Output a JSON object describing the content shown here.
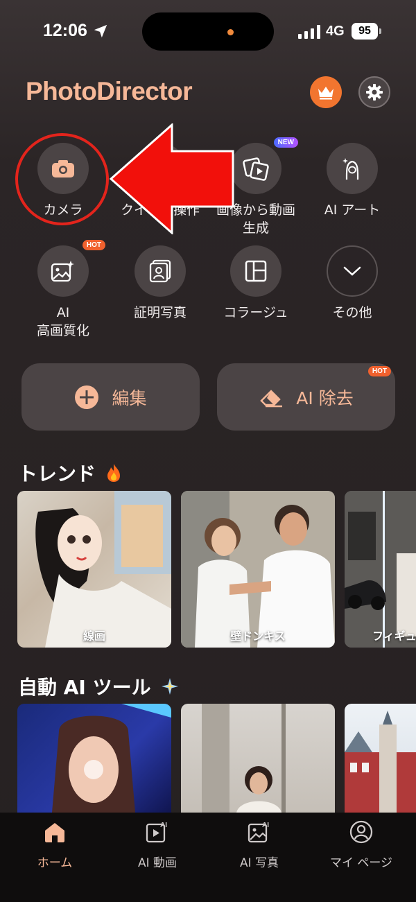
{
  "status_bar": {
    "time": "12:06",
    "network": "4G",
    "battery": "95"
  },
  "header": {
    "title": "PhotoDirector"
  },
  "tools": [
    {
      "label": "カメラ",
      "icon": "camera-icon"
    },
    {
      "label": "クイック操作",
      "icon": "quick-action-icon"
    },
    {
      "label": "画像から動画\n生成",
      "icon": "image-to-video-icon",
      "badge": "NEW"
    },
    {
      "label": "AI アート",
      "icon": "ai-art-icon"
    },
    {
      "label": "AI\n高画質化",
      "icon": "enhance-icon",
      "badge": "HOT"
    },
    {
      "label": "証明写真",
      "icon": "id-photo-icon"
    },
    {
      "label": "コラージュ",
      "icon": "collage-icon"
    },
    {
      "label": "その他",
      "icon": "chevron-down-icon"
    }
  ],
  "actions": {
    "edit": {
      "label": "編集",
      "icon": "plus-icon"
    },
    "remove": {
      "label": "AI 除去",
      "icon": "eraser-icon",
      "badge": "HOT"
    }
  },
  "sections": {
    "trend": {
      "title": "トレンド",
      "icon": "fire-icon",
      "cards": [
        {
          "caption": "線画"
        },
        {
          "caption": "壁ドンキス"
        },
        {
          "caption": "フィギュ"
        }
      ]
    },
    "auto_ai": {
      "title": "自動 AI ツール",
      "icon": "sparkle-icon"
    }
  },
  "nav": [
    {
      "label": "ホーム",
      "icon": "home-icon",
      "active": true
    },
    {
      "label": "AI 動画",
      "icon": "ai-video-icon"
    },
    {
      "label": "AI 写真",
      "icon": "ai-photo-icon"
    },
    {
      "label": "マイ ページ",
      "icon": "profile-icon"
    }
  ],
  "colors": {
    "accent": "#f6b898",
    "orange": "#f2752f",
    "annotation_red": "#e3241c"
  }
}
